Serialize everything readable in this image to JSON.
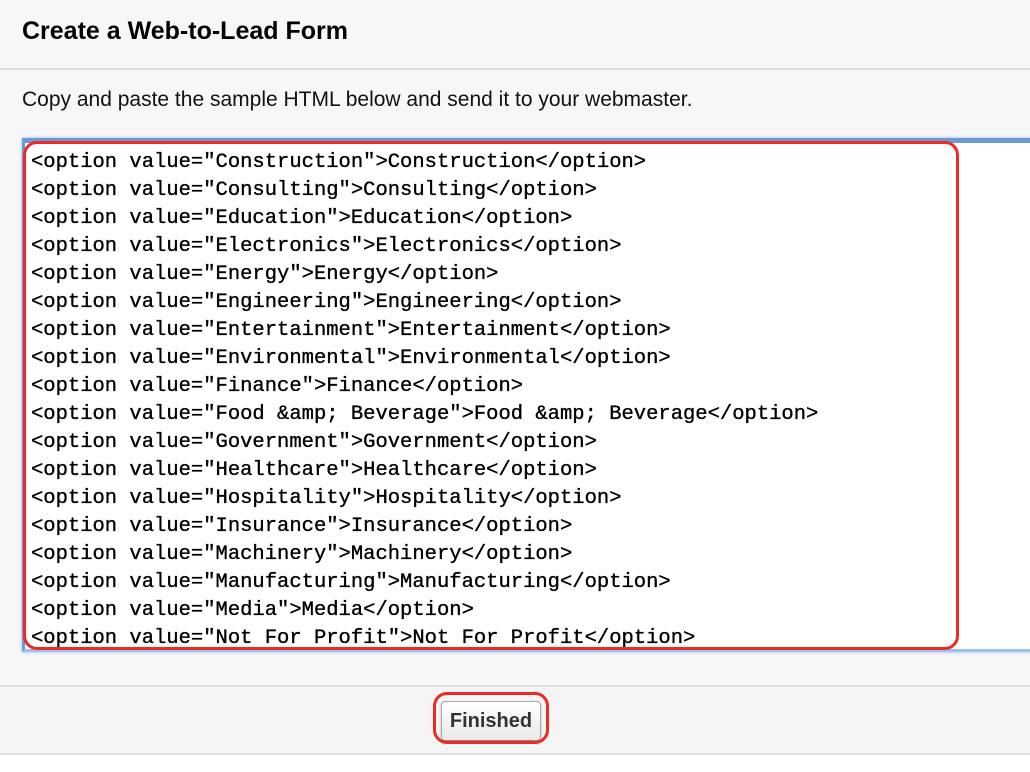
{
  "header": {
    "title": "Create a Web-to-Lead Form"
  },
  "instruction": "Copy and paste the sample HTML below and send it to your webmaster.",
  "code_textarea": {
    "lines": [
      "<option value=\"Construction\">Construction</option>",
      "<option value=\"Consulting\">Consulting</option>",
      "<option value=\"Education\">Education</option>",
      "<option value=\"Electronics\">Electronics</option>",
      "<option value=\"Energy\">Energy</option>",
      "<option value=\"Engineering\">Engineering</option>",
      "<option value=\"Entertainment\">Entertainment</option>",
      "<option value=\"Environmental\">Environmental</option>",
      "<option value=\"Finance\">Finance</option>",
      "<option value=\"Food &amp; Beverage\">Food &amp; Beverage</option>",
      "<option value=\"Government\">Government</option>",
      "<option value=\"Healthcare\">Healthcare</option>",
      "<option value=\"Hospitality\">Hospitality</option>",
      "<option value=\"Insurance\">Insurance</option>",
      "<option value=\"Machinery\">Machinery</option>",
      "<option value=\"Manufacturing\">Manufacturing</option>",
      "<option value=\"Media\">Media</option>",
      "<option value=\"Not For Profit\">Not For Profit</option>"
    ]
  },
  "footer": {
    "finished_label": "Finished"
  },
  "colors": {
    "annotation": "#ee2a24",
    "focus_border": "#6d9ad6"
  }
}
